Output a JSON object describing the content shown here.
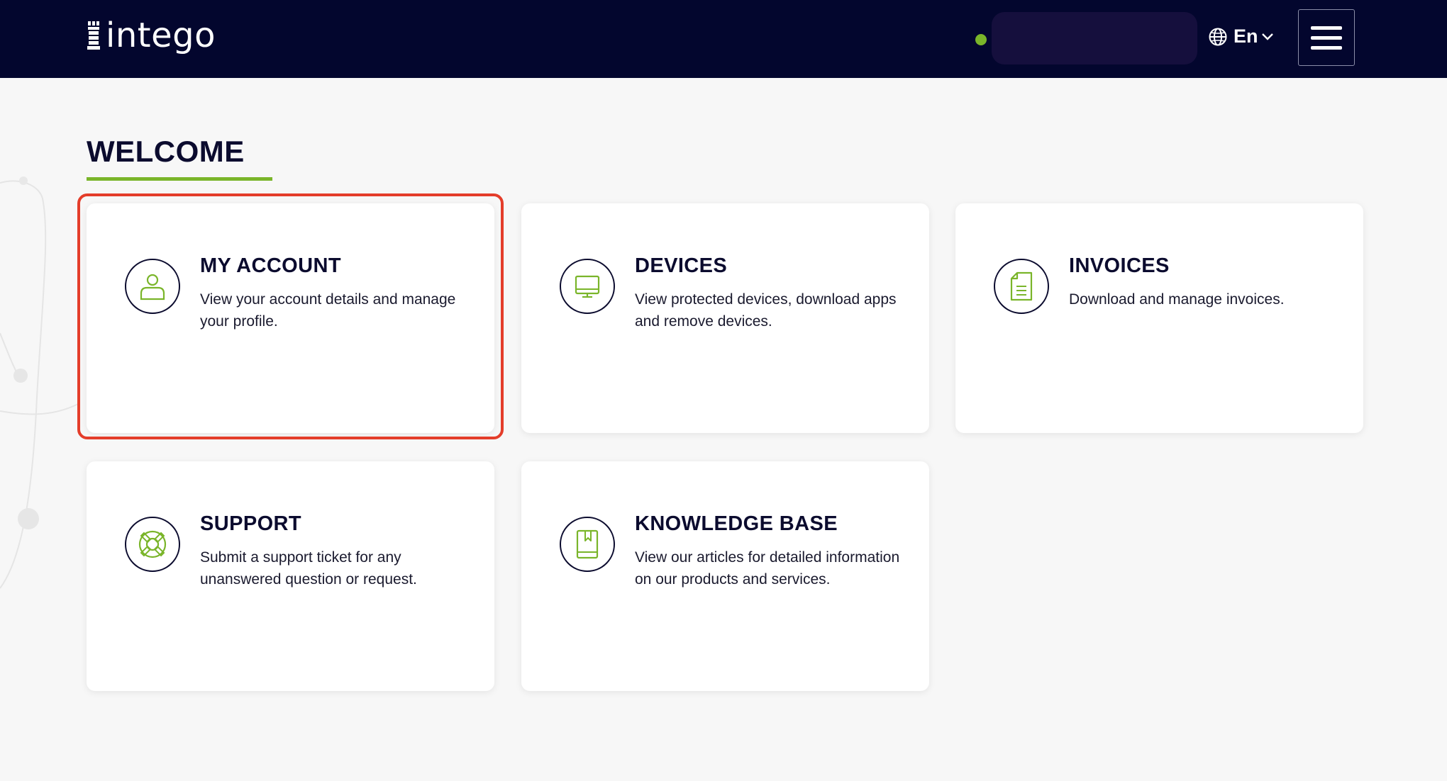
{
  "header": {
    "brand": "intego",
    "language": "En",
    "colors": {
      "background": "#03062e",
      "accent": "#7ab52a",
      "status": "#7ab52a"
    }
  },
  "main": {
    "title": "WELCOME",
    "cards": [
      {
        "title": "MY ACCOUNT",
        "description": "View your account details and manage your profile.",
        "icon": "user-icon"
      },
      {
        "title": "DEVICES",
        "description": "View protected devices, download apps and remove devices.",
        "icon": "monitor-icon"
      },
      {
        "title": "INVOICES",
        "description": "Download and manage invoices.",
        "icon": "document-icon"
      },
      {
        "title": "SUPPORT",
        "description": "Submit a support ticket for any unanswered question or request.",
        "icon": "lifebuoy-icon"
      },
      {
        "title": "KNOWLEDGE BASE",
        "description": "View our articles for detailed information on our products and services.",
        "icon": "book-icon"
      }
    ],
    "highlight_color": "#e43d2a"
  }
}
